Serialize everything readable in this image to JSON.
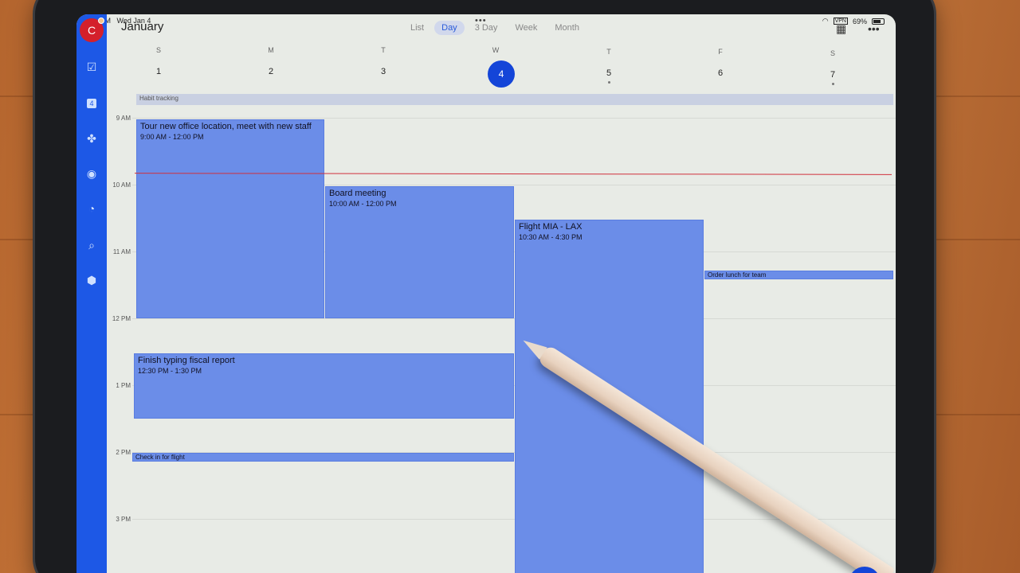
{
  "status": {
    "time": "9:51 AM",
    "date": "Wed Jan 4",
    "battery": "69%",
    "vpn": "VPN"
  },
  "header": {
    "title": "January",
    "tabs": [
      "List",
      "Day",
      "3 Day",
      "Week",
      "Month"
    ],
    "active_tab": "Day"
  },
  "sidebar": {
    "avatar_letter": "C",
    "calendar_badge": "4"
  },
  "week": [
    {
      "letter": "S",
      "num": "1"
    },
    {
      "letter": "M",
      "num": "2"
    },
    {
      "letter": "T",
      "num": "3"
    },
    {
      "letter": "W",
      "num": "4"
    },
    {
      "letter": "T",
      "num": "5"
    },
    {
      "letter": "F",
      "num": "6"
    },
    {
      "letter": "S",
      "num": "7"
    }
  ],
  "allday": "Habit tracking",
  "hours": [
    "9 AM",
    "10 AM",
    "11 AM",
    "12 PM",
    "1 PM",
    "2 PM",
    "3 PM"
  ],
  "events": [
    {
      "title": "Tour new office location, meet with new staff",
      "time": "9:00 AM - 12:00 PM"
    },
    {
      "title": "Board meeting",
      "time": "10:00 AM - 12:00 PM"
    },
    {
      "title": "Flight MIA - LAX",
      "time": "10:30 AM - 4:30 PM"
    },
    {
      "title": "Order lunch for team"
    },
    {
      "title": "Finish typing fiscal report",
      "time": "12:30 PM - 1:30 PM"
    },
    {
      "title": "Check in for flight"
    }
  ]
}
